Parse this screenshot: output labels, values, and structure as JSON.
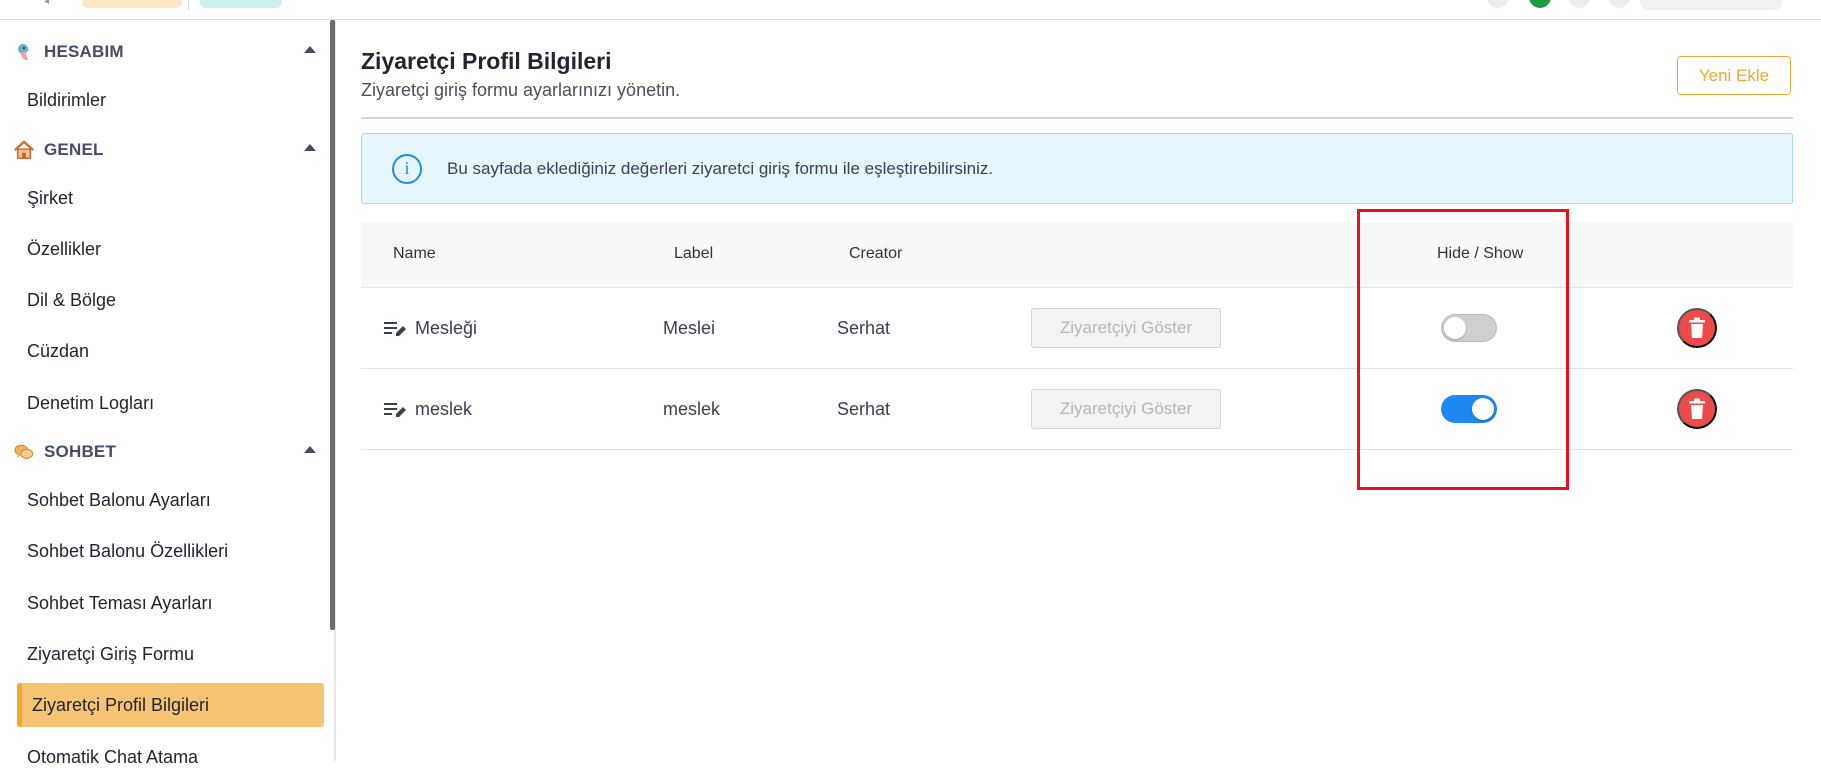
{
  "colors": {
    "accent": "#f0a832",
    "active_bg": "#f6c473",
    "toggle_on": "#1e88f2",
    "danger": "#ef4a4a",
    "info_bg": "#e6f6fd",
    "highlight": "#e8101a"
  },
  "sidebar": {
    "sections": [
      {
        "label": "HESABIM",
        "icon": "bird-icon",
        "items": [
          {
            "label": "Bildirimler"
          }
        ]
      },
      {
        "label": "GENEL",
        "icon": "house-icon",
        "items": [
          {
            "label": "Şirket"
          },
          {
            "label": "Özellikler"
          },
          {
            "label": "Dil & Bölge"
          },
          {
            "label": "Cüzdan"
          },
          {
            "label": "Denetim Logları"
          }
        ]
      },
      {
        "label": "SOHBET",
        "icon": "chat-bubbles-icon",
        "items": [
          {
            "label": "Sohbet Balonu Ayarları"
          },
          {
            "label": "Sohbet Balonu Özellikleri"
          },
          {
            "label": "Sohbet Teması Ayarları"
          },
          {
            "label": "Ziyaretçi Giriş Formu"
          },
          {
            "label": "Ziyaretçi Profil Bilgileri",
            "active": true
          },
          {
            "label": "Otomatik Chat Atama"
          }
        ]
      }
    ]
  },
  "header": {
    "title": "Ziyaretçi Profil Bilgileri",
    "subtitle": "Ziyaretçi giriş formu ayarlarınızı yönetin.",
    "new_button": "Yeni Ekle"
  },
  "info": {
    "icon": "info-icon",
    "text": "Bu sayfada eklediğiniz değerleri ziyaretci giriş formu ile eşleştirebilirsiniz."
  },
  "table": {
    "columns": [
      "Name",
      "Label",
      "Creator",
      "Hide / Show"
    ],
    "rows": [
      {
        "name": "Mesleği",
        "label": "Meslei",
        "creator": "Serhat",
        "show_button": "Ziyaretçiyi Göster",
        "visible": false
      },
      {
        "name": "meslek",
        "label": "meslek",
        "creator": "Serhat",
        "show_button": "Ziyaretçiyi Göster",
        "visible": true
      }
    ]
  }
}
